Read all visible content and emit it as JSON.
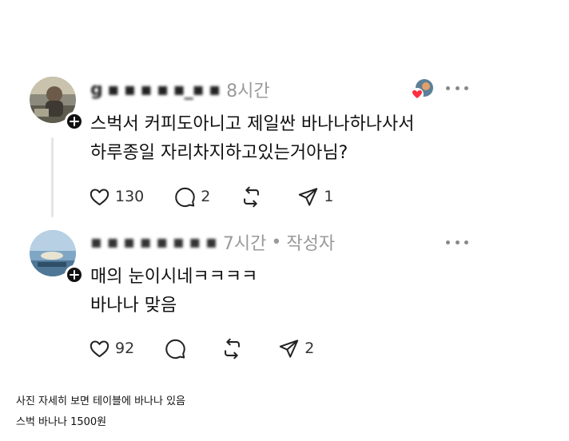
{
  "posts": [
    {
      "username": "g ▪ ▪ ▪ ▪ ▪_▪ ▪",
      "time": "8시간",
      "line1": "스벅서 커피도아니고 제일싼 바나나하나사서",
      "line2": "하루종일 자리차지하고있는거아님?",
      "likes": "130",
      "comments": "2",
      "reposts": "",
      "shares": "1"
    },
    {
      "username": "▪ ▪ ▪ ▪ ▪ ▪ ▪ ▪",
      "time": "7시간",
      "separator": "•",
      "author_tag": "작성자",
      "line1": "매의 눈이시네ㅋㅋㅋㅋ",
      "line2": "바나나 맞음",
      "likes": "92",
      "comments": "",
      "reposts": "",
      "shares": "2"
    }
  ],
  "captions": {
    "line1": "사진 자세히 보면 테이블에 바나나 있음",
    "line2": "스벅 바나나 1500원"
  },
  "colors": {
    "text": "#111111",
    "meta": "#9a9a9a",
    "thread_line": "#e5e5e5",
    "like_heart": "#ff3040"
  }
}
